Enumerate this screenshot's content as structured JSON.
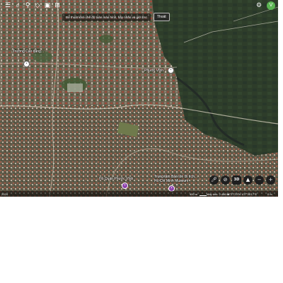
{
  "toolbar": {
    "icons": [
      "menu-icon",
      "search-icon",
      "location-pin-icon",
      "layers-icon",
      "project-icon",
      "ruler-icon",
      "share-icon",
      "more-icon"
    ]
  },
  "fullscreen": {
    "message": "Để thoát khỏi chế độ toàn màn hình, hãy nhấn và giữ",
    "key_hint": "Esc",
    "exit_label": "Thoát"
  },
  "account": {
    "avatar_letter": "V"
  },
  "labels": {
    "school": "Trường Cao đẳng...",
    "place_top": "...Phước Vĩnh",
    "museum": "Trung tâm Bảo tồn Di tích...\nHồ Chí Minh Museum",
    "street": "Hồ Quán Phước Vĩnh"
  },
  "controls": {
    "mode_3d": "3D",
    "zoom_out": "−",
    "zoom_in": "+"
  },
  "status": {
    "left": "2024",
    "scale": "400 m",
    "camera": "Máy ảnh: 2.486 m",
    "coords": "16°27'23\"N 107°35'17\"E",
    "extra": "0 m"
  },
  "colors": {
    "urban_base": "#5a5446",
    "fields": "#2f3f2a",
    "river": "#26302a"
  }
}
